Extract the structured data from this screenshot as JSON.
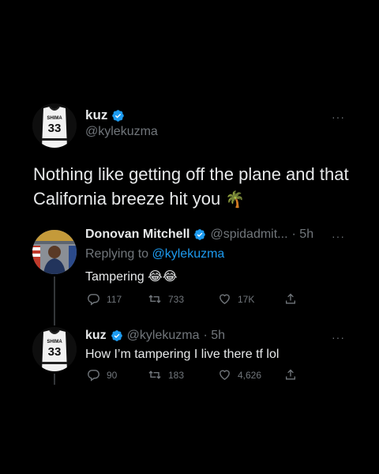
{
  "main_tweet": {
    "display_name": "kuz",
    "handle": "@kylekuzma",
    "text": "Nothing like getting off the plane and that California breeze hit you",
    "emoji": "🌴",
    "more": "···"
  },
  "reply1": {
    "display_name": "Donovan Mitchell",
    "handle": "@spidadmit...",
    "time": "· 5h",
    "replying_to_prefix": "Replying to",
    "replying_to_handle": "@kylekuzma",
    "text": "Tampering",
    "emoji": "😂😂",
    "more": "···",
    "stats": {
      "replies": "117",
      "retweets": "733",
      "likes": "17K"
    }
  },
  "reply2": {
    "display_name": "kuz",
    "handle": "@kylekuzma",
    "time": "· 5h",
    "text": "How I’m tampering I live there tf lol",
    "more": "···",
    "stats": {
      "replies": "90",
      "retweets": "183",
      "likes": "4,626"
    }
  },
  "jersey_text": {
    "brand": "SHIMA",
    "number": "33"
  },
  "colors": {
    "verified": "#1d9bf0",
    "link": "#1d9bf0",
    "muted": "#71767b",
    "text": "#e7e9ea",
    "background": "#000000"
  }
}
